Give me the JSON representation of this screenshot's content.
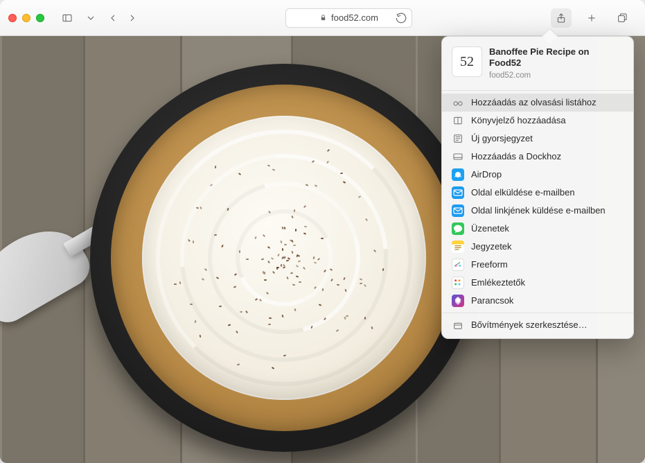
{
  "toolbar": {
    "address": "food52.com"
  },
  "share": {
    "thumb_text": "52",
    "title": "Banoffee Pie Recipe on Food52",
    "subtitle": "food52.com",
    "items": [
      {
        "label": "Hozzáadás az olvasási listához",
        "icon": "glasses",
        "highlight": true
      },
      {
        "label": "Könyvjelző hozzáadása",
        "icon": "bookmark"
      },
      {
        "label": "Új gyorsjegyzet",
        "icon": "quicknote"
      },
      {
        "label": "Hozzáadás a Dockhoz",
        "icon": "dock"
      },
      {
        "label": "AirDrop",
        "icon": "airdrop"
      },
      {
        "label": "Oldal elküldése e-mailben",
        "icon": "mail"
      },
      {
        "label": "Oldal linkjének küldése e-mailben",
        "icon": "link"
      },
      {
        "label": "Üzenetek",
        "icon": "messages"
      },
      {
        "label": "Jegyzetek",
        "icon": "notes"
      },
      {
        "label": "Freeform",
        "icon": "freeform"
      },
      {
        "label": "Emlékeztetők",
        "icon": "reminders"
      },
      {
        "label": "Parancsok",
        "icon": "shortcuts"
      }
    ],
    "footer": "Bővítmények szerkesztése…"
  }
}
